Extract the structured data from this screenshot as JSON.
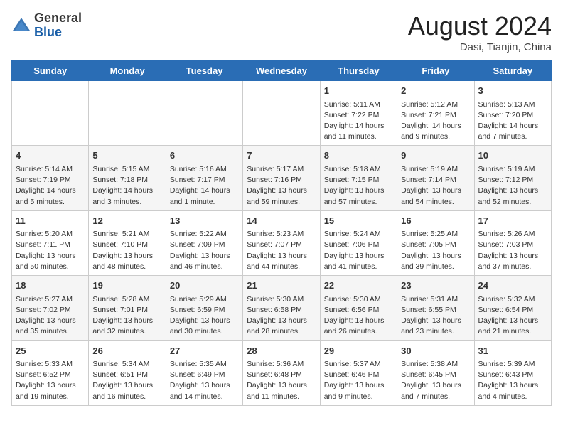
{
  "header": {
    "logo_line1": "General",
    "logo_line2": "Blue",
    "month_title": "August 2024",
    "location": "Dasi, Tianjin, China"
  },
  "weekdays": [
    "Sunday",
    "Monday",
    "Tuesday",
    "Wednesday",
    "Thursday",
    "Friday",
    "Saturday"
  ],
  "weeks": [
    [
      {
        "day": "",
        "info": ""
      },
      {
        "day": "",
        "info": ""
      },
      {
        "day": "",
        "info": ""
      },
      {
        "day": "",
        "info": ""
      },
      {
        "day": "1",
        "info": "Sunrise: 5:11 AM\nSunset: 7:22 PM\nDaylight: 14 hours\nand 11 minutes."
      },
      {
        "day": "2",
        "info": "Sunrise: 5:12 AM\nSunset: 7:21 PM\nDaylight: 14 hours\nand 9 minutes."
      },
      {
        "day": "3",
        "info": "Sunrise: 5:13 AM\nSunset: 7:20 PM\nDaylight: 14 hours\nand 7 minutes."
      }
    ],
    [
      {
        "day": "4",
        "info": "Sunrise: 5:14 AM\nSunset: 7:19 PM\nDaylight: 14 hours\nand 5 minutes."
      },
      {
        "day": "5",
        "info": "Sunrise: 5:15 AM\nSunset: 7:18 PM\nDaylight: 14 hours\nand 3 minutes."
      },
      {
        "day": "6",
        "info": "Sunrise: 5:16 AM\nSunset: 7:17 PM\nDaylight: 14 hours\nand 1 minute."
      },
      {
        "day": "7",
        "info": "Sunrise: 5:17 AM\nSunset: 7:16 PM\nDaylight: 13 hours\nand 59 minutes."
      },
      {
        "day": "8",
        "info": "Sunrise: 5:18 AM\nSunset: 7:15 PM\nDaylight: 13 hours\nand 57 minutes."
      },
      {
        "day": "9",
        "info": "Sunrise: 5:19 AM\nSunset: 7:14 PM\nDaylight: 13 hours\nand 54 minutes."
      },
      {
        "day": "10",
        "info": "Sunrise: 5:19 AM\nSunset: 7:12 PM\nDaylight: 13 hours\nand 52 minutes."
      }
    ],
    [
      {
        "day": "11",
        "info": "Sunrise: 5:20 AM\nSunset: 7:11 PM\nDaylight: 13 hours\nand 50 minutes."
      },
      {
        "day": "12",
        "info": "Sunrise: 5:21 AM\nSunset: 7:10 PM\nDaylight: 13 hours\nand 48 minutes."
      },
      {
        "day": "13",
        "info": "Sunrise: 5:22 AM\nSunset: 7:09 PM\nDaylight: 13 hours\nand 46 minutes."
      },
      {
        "day": "14",
        "info": "Sunrise: 5:23 AM\nSunset: 7:07 PM\nDaylight: 13 hours\nand 44 minutes."
      },
      {
        "day": "15",
        "info": "Sunrise: 5:24 AM\nSunset: 7:06 PM\nDaylight: 13 hours\nand 41 minutes."
      },
      {
        "day": "16",
        "info": "Sunrise: 5:25 AM\nSunset: 7:05 PM\nDaylight: 13 hours\nand 39 minutes."
      },
      {
        "day": "17",
        "info": "Sunrise: 5:26 AM\nSunset: 7:03 PM\nDaylight: 13 hours\nand 37 minutes."
      }
    ],
    [
      {
        "day": "18",
        "info": "Sunrise: 5:27 AM\nSunset: 7:02 PM\nDaylight: 13 hours\nand 35 minutes."
      },
      {
        "day": "19",
        "info": "Sunrise: 5:28 AM\nSunset: 7:01 PM\nDaylight: 13 hours\nand 32 minutes."
      },
      {
        "day": "20",
        "info": "Sunrise: 5:29 AM\nSunset: 6:59 PM\nDaylight: 13 hours\nand 30 minutes."
      },
      {
        "day": "21",
        "info": "Sunrise: 5:30 AM\nSunset: 6:58 PM\nDaylight: 13 hours\nand 28 minutes."
      },
      {
        "day": "22",
        "info": "Sunrise: 5:30 AM\nSunset: 6:56 PM\nDaylight: 13 hours\nand 26 minutes."
      },
      {
        "day": "23",
        "info": "Sunrise: 5:31 AM\nSunset: 6:55 PM\nDaylight: 13 hours\nand 23 minutes."
      },
      {
        "day": "24",
        "info": "Sunrise: 5:32 AM\nSunset: 6:54 PM\nDaylight: 13 hours\nand 21 minutes."
      }
    ],
    [
      {
        "day": "25",
        "info": "Sunrise: 5:33 AM\nSunset: 6:52 PM\nDaylight: 13 hours\nand 19 minutes."
      },
      {
        "day": "26",
        "info": "Sunrise: 5:34 AM\nSunset: 6:51 PM\nDaylight: 13 hours\nand 16 minutes."
      },
      {
        "day": "27",
        "info": "Sunrise: 5:35 AM\nSunset: 6:49 PM\nDaylight: 13 hours\nand 14 minutes."
      },
      {
        "day": "28",
        "info": "Sunrise: 5:36 AM\nSunset: 6:48 PM\nDaylight: 13 hours\nand 11 minutes."
      },
      {
        "day": "29",
        "info": "Sunrise: 5:37 AM\nSunset: 6:46 PM\nDaylight: 13 hours\nand 9 minutes."
      },
      {
        "day": "30",
        "info": "Sunrise: 5:38 AM\nSunset: 6:45 PM\nDaylight: 13 hours\nand 7 minutes."
      },
      {
        "day": "31",
        "info": "Sunrise: 5:39 AM\nSunset: 6:43 PM\nDaylight: 13 hours\nand 4 minutes."
      }
    ]
  ]
}
